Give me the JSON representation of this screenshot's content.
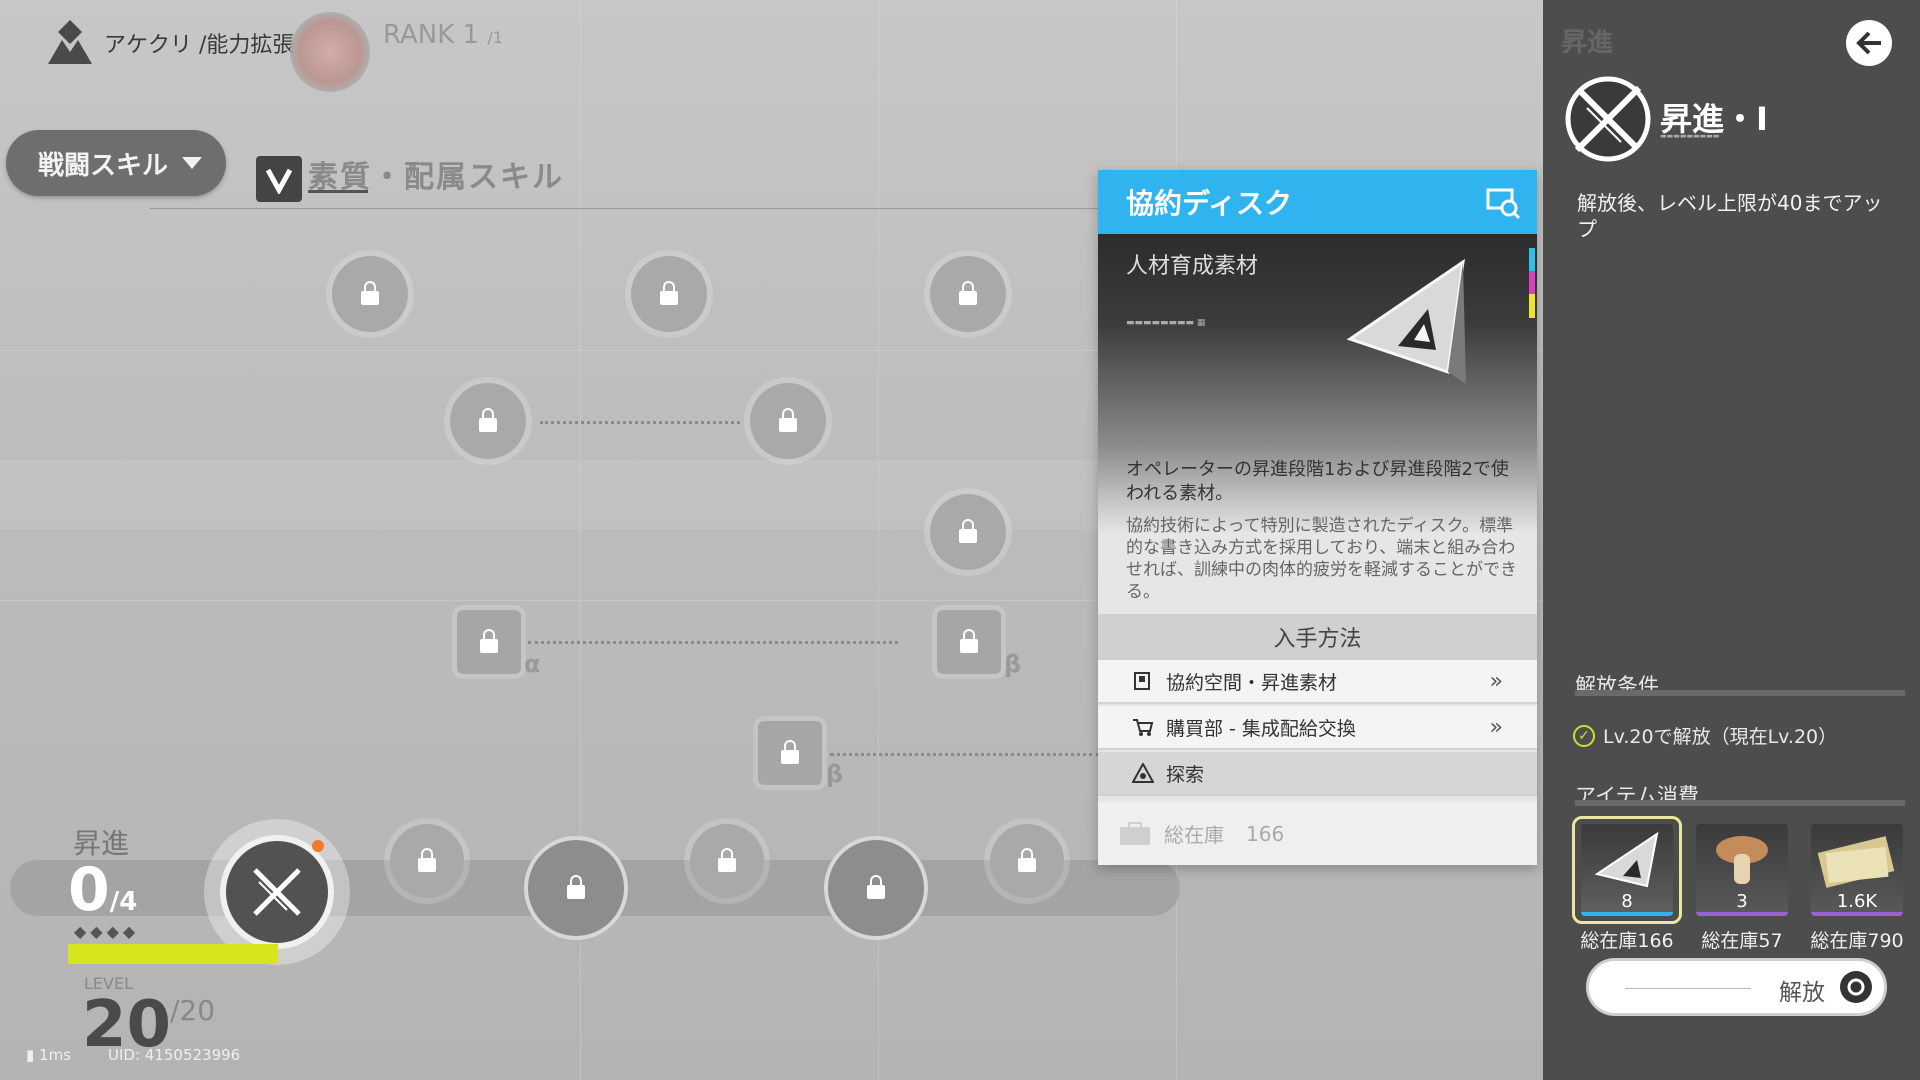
{
  "header": {
    "breadcrumb": "アケクリ /能力拡張",
    "rank_label": "RANK 1",
    "rank_max": "/1"
  },
  "skill_select": {
    "label": "戦闘スキル"
  },
  "filter": {
    "label": "素質・配属スキル"
  },
  "markers": {
    "alpha": "α",
    "beta": "β"
  },
  "progress": {
    "ascension_label": "昇進",
    "ascension_current": "0",
    "ascension_max": "/4",
    "diamonds": "◆◆◆◆",
    "level_caption": "LEVEL",
    "level": "20",
    "level_max": "/20",
    "xp_fill": 1.0
  },
  "status": {
    "ping": "1ms",
    "uid": "UID: 4150523996"
  },
  "item_card": {
    "title": "協約ディスク",
    "category": "人材育成素材",
    "description": "オペレーターの昇進段階1および昇進段階2で使われる素材。",
    "lore": "協約技術によって特別に製造されたディスク。標準的な書き込み方式を採用しており、端末と組み合わせれば、訓練中の肉体的疲労を軽減することができる。",
    "source_header": "入手方法",
    "sources": [
      {
        "label": "協約空間・昇進素材",
        "icon": "flag-icon"
      },
      {
        "label": "購買部 - 集成配給交換",
        "icon": "cart-icon"
      },
      {
        "label": "探索",
        "icon": "explore-icon"
      }
    ],
    "stock_label": "総在庫",
    "stock_value": "166",
    "colors": {
      "header": "#2fb4ef"
    }
  },
  "panel": {
    "ghost_title": "昇進",
    "title": "昇進・Ⅰ",
    "description": "解放後、レベル上限が40までアップ",
    "conditions_title": "解放条件",
    "condition": "Lv.20で解放（現在Lv.20）",
    "items_title": "アイテム消費",
    "items": [
      {
        "name": "disk-item",
        "count": "8",
        "stock": "総在庫166",
        "rarity_color": "#2fb4ef"
      },
      {
        "name": "mushroom-item",
        "count": "3",
        "stock": "総在庫57",
        "rarity_color": "#9b5fd6"
      },
      {
        "name": "money-item",
        "count": "1.6K",
        "stock": "総在庫790",
        "rarity_color": "#9b5fd6"
      }
    ],
    "release_label": "解放",
    "accent_color": "#cfe02e"
  }
}
